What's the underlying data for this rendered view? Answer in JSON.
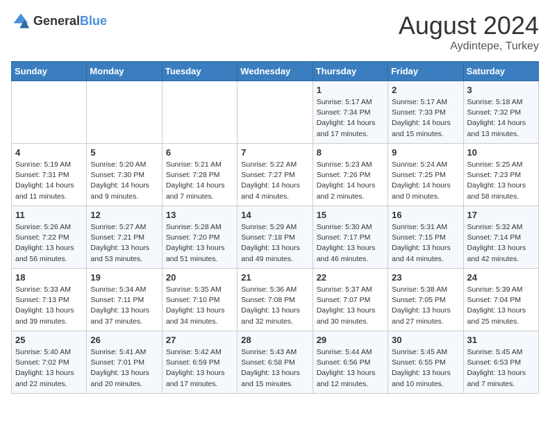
{
  "header": {
    "logo_general": "General",
    "logo_blue": "Blue",
    "month_year": "August 2024",
    "location": "Aydintepe, Turkey"
  },
  "weekdays": [
    "Sunday",
    "Monday",
    "Tuesday",
    "Wednesday",
    "Thursday",
    "Friday",
    "Saturday"
  ],
  "weeks": [
    [
      {
        "day": "",
        "info": ""
      },
      {
        "day": "",
        "info": ""
      },
      {
        "day": "",
        "info": ""
      },
      {
        "day": "",
        "info": ""
      },
      {
        "day": "1",
        "info": "Sunrise: 5:17 AM\nSunset: 7:34 PM\nDaylight: 14 hours and 17 minutes."
      },
      {
        "day": "2",
        "info": "Sunrise: 5:17 AM\nSunset: 7:33 PM\nDaylight: 14 hours and 15 minutes."
      },
      {
        "day": "3",
        "info": "Sunrise: 5:18 AM\nSunset: 7:32 PM\nDaylight: 14 hours and 13 minutes."
      }
    ],
    [
      {
        "day": "4",
        "info": "Sunrise: 5:19 AM\nSunset: 7:31 PM\nDaylight: 14 hours and 11 minutes."
      },
      {
        "day": "5",
        "info": "Sunrise: 5:20 AM\nSunset: 7:30 PM\nDaylight: 14 hours and 9 minutes."
      },
      {
        "day": "6",
        "info": "Sunrise: 5:21 AM\nSunset: 7:28 PM\nDaylight: 14 hours and 7 minutes."
      },
      {
        "day": "7",
        "info": "Sunrise: 5:22 AM\nSunset: 7:27 PM\nDaylight: 14 hours and 4 minutes."
      },
      {
        "day": "8",
        "info": "Sunrise: 5:23 AM\nSunset: 7:26 PM\nDaylight: 14 hours and 2 minutes."
      },
      {
        "day": "9",
        "info": "Sunrise: 5:24 AM\nSunset: 7:25 PM\nDaylight: 14 hours and 0 minutes."
      },
      {
        "day": "10",
        "info": "Sunrise: 5:25 AM\nSunset: 7:23 PM\nDaylight: 13 hours and 58 minutes."
      }
    ],
    [
      {
        "day": "11",
        "info": "Sunrise: 5:26 AM\nSunset: 7:22 PM\nDaylight: 13 hours and 56 minutes."
      },
      {
        "day": "12",
        "info": "Sunrise: 5:27 AM\nSunset: 7:21 PM\nDaylight: 13 hours and 53 minutes."
      },
      {
        "day": "13",
        "info": "Sunrise: 5:28 AM\nSunset: 7:20 PM\nDaylight: 13 hours and 51 minutes."
      },
      {
        "day": "14",
        "info": "Sunrise: 5:29 AM\nSunset: 7:18 PM\nDaylight: 13 hours and 49 minutes."
      },
      {
        "day": "15",
        "info": "Sunrise: 5:30 AM\nSunset: 7:17 PM\nDaylight: 13 hours and 46 minutes."
      },
      {
        "day": "16",
        "info": "Sunrise: 5:31 AM\nSunset: 7:15 PM\nDaylight: 13 hours and 44 minutes."
      },
      {
        "day": "17",
        "info": "Sunrise: 5:32 AM\nSunset: 7:14 PM\nDaylight: 13 hours and 42 minutes."
      }
    ],
    [
      {
        "day": "18",
        "info": "Sunrise: 5:33 AM\nSunset: 7:13 PM\nDaylight: 13 hours and 39 minutes."
      },
      {
        "day": "19",
        "info": "Sunrise: 5:34 AM\nSunset: 7:11 PM\nDaylight: 13 hours and 37 minutes."
      },
      {
        "day": "20",
        "info": "Sunrise: 5:35 AM\nSunset: 7:10 PM\nDaylight: 13 hours and 34 minutes."
      },
      {
        "day": "21",
        "info": "Sunrise: 5:36 AM\nSunset: 7:08 PM\nDaylight: 13 hours and 32 minutes."
      },
      {
        "day": "22",
        "info": "Sunrise: 5:37 AM\nSunset: 7:07 PM\nDaylight: 13 hours and 30 minutes."
      },
      {
        "day": "23",
        "info": "Sunrise: 5:38 AM\nSunset: 7:05 PM\nDaylight: 13 hours and 27 minutes."
      },
      {
        "day": "24",
        "info": "Sunrise: 5:39 AM\nSunset: 7:04 PM\nDaylight: 13 hours and 25 minutes."
      }
    ],
    [
      {
        "day": "25",
        "info": "Sunrise: 5:40 AM\nSunset: 7:02 PM\nDaylight: 13 hours and 22 minutes."
      },
      {
        "day": "26",
        "info": "Sunrise: 5:41 AM\nSunset: 7:01 PM\nDaylight: 13 hours and 20 minutes."
      },
      {
        "day": "27",
        "info": "Sunrise: 5:42 AM\nSunset: 6:59 PM\nDaylight: 13 hours and 17 minutes."
      },
      {
        "day": "28",
        "info": "Sunrise: 5:43 AM\nSunset: 6:58 PM\nDaylight: 13 hours and 15 minutes."
      },
      {
        "day": "29",
        "info": "Sunrise: 5:44 AM\nSunset: 6:56 PM\nDaylight: 13 hours and 12 minutes."
      },
      {
        "day": "30",
        "info": "Sunrise: 5:45 AM\nSunset: 6:55 PM\nDaylight: 13 hours and 10 minutes."
      },
      {
        "day": "31",
        "info": "Sunrise: 5:45 AM\nSunset: 6:53 PM\nDaylight: 13 hours and 7 minutes."
      }
    ]
  ]
}
